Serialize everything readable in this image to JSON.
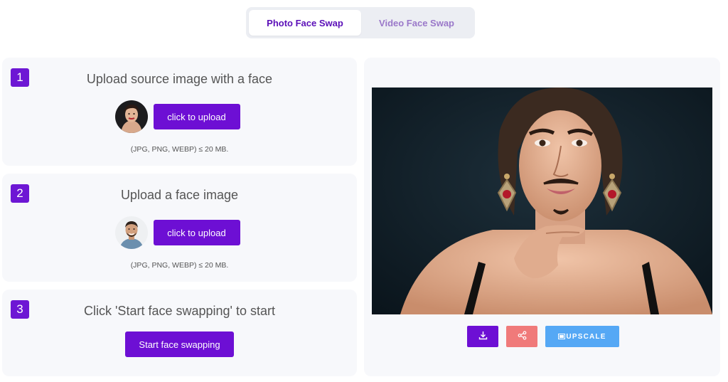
{
  "tabs": [
    {
      "label": "Photo Face Swap",
      "active": true
    },
    {
      "label": "Video Face Swap",
      "active": false
    }
  ],
  "steps": [
    {
      "number": "1",
      "title": "Upload source image with a face",
      "button": "click to upload",
      "hint": "(JPG, PNG, WEBP) ≤ 20 MB."
    },
    {
      "number": "2",
      "title": "Upload a face image",
      "button": "click to upload",
      "hint": "(JPG, PNG, WEBP) ≤ 20 MB."
    },
    {
      "number": "3",
      "title": "Click 'Start face swapping' to start",
      "button": "Start face swapping"
    }
  ],
  "result": {
    "actions": {
      "download_icon": "download-icon",
      "share_icon": "share-icon",
      "upscale_label": "UPSCALE"
    }
  },
  "colors": {
    "accent": "#6d0fd4",
    "share": "#f07a7a",
    "upscale": "#55a8f5",
    "card_bg": "#f7f8fb"
  }
}
